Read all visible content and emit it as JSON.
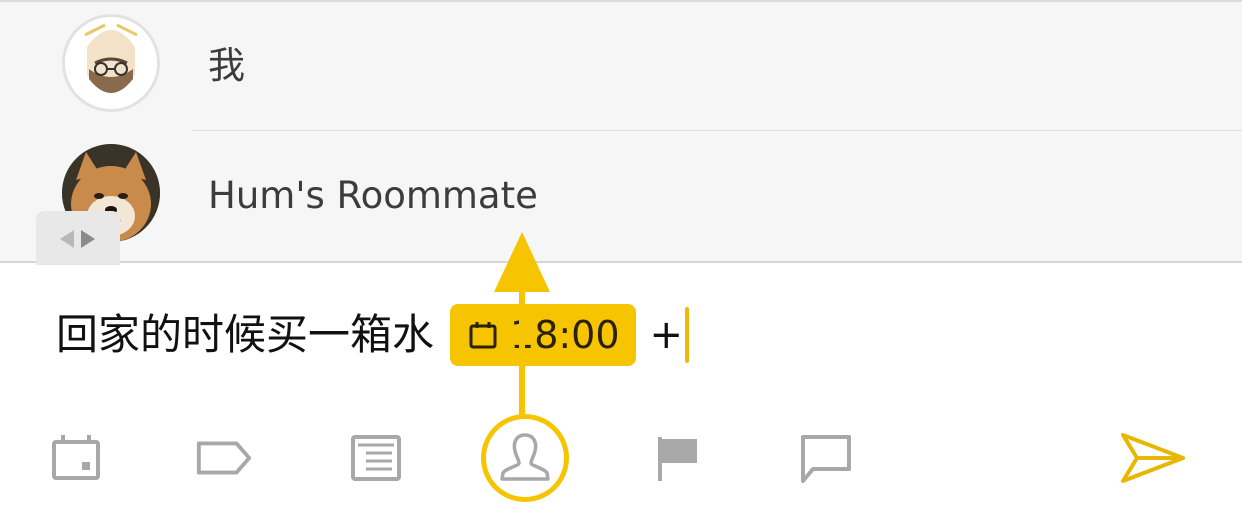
{
  "suggestions": {
    "contacts": [
      {
        "name": "我",
        "avatar_icon": "cartoon-face-avatar"
      },
      {
        "name": "Hum's Roommate",
        "avatar_icon": "shiba-dog-avatar"
      }
    ],
    "handle_icon": "left-right-arrows-icon"
  },
  "compose": {
    "text": "回家的时候买一箱水",
    "date_chip": {
      "icon": "calendar-icon",
      "time": "18:00"
    },
    "trailing_text": "+"
  },
  "toolbar": {
    "items": [
      {
        "icon": "calendar-icon",
        "state": "inactive"
      },
      {
        "icon": "tag-icon",
        "state": "inactive"
      },
      {
        "icon": "list-icon",
        "state": "inactive"
      },
      {
        "icon": "person-icon",
        "state": "highlighted"
      },
      {
        "icon": "flag-icon",
        "state": "inactive"
      },
      {
        "icon": "comment-icon",
        "state": "inactive"
      }
    ],
    "send_icon": "send-icon"
  },
  "colors": {
    "accent": "#f7c402",
    "icon_gray": "#a8a8a8",
    "panel_bg": "#f6f6f6",
    "send": "#e8b800"
  }
}
